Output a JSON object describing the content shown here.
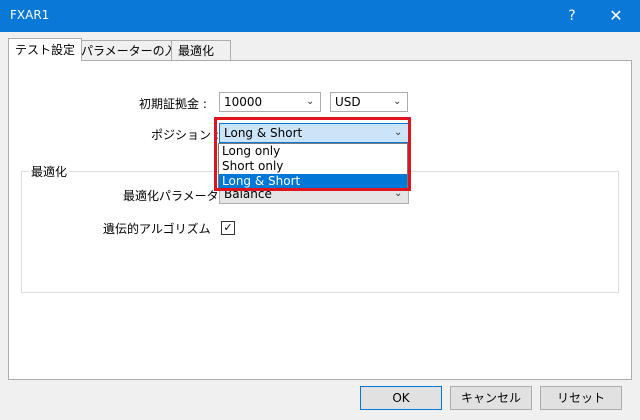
{
  "window": {
    "title": "FXAR1",
    "help_glyph": "?",
    "close_glyph": "✕"
  },
  "tabs": [
    {
      "label": "テスト設定"
    },
    {
      "label": "パラメーターの入力"
    },
    {
      "label": "最適化"
    }
  ],
  "form": {
    "deposit_label": "初期証拠金 :",
    "deposit_value": "10000",
    "currency_value": "USD",
    "position_label": "ポジション :",
    "position_value": "Long & Short",
    "dropdown_options": [
      "Long only",
      "Short only",
      "Long & Short"
    ],
    "selected_option_index": 2
  },
  "optimization": {
    "group_title": "最適化",
    "param_label": "最適化パラメータ :",
    "param_value": "Balance",
    "genetic_label": "遺伝的アルゴリズム",
    "genetic_checked": true,
    "check_glyph": "✓"
  },
  "buttons": {
    "ok": "OK",
    "cancel": "キャンセル",
    "reset": "リセット"
  },
  "colors": {
    "titlebar": "#0a78d7",
    "highlight": "#e0141e",
    "selection": "#0078d7"
  },
  "icons": {
    "chevron": "chevron-down-icon"
  }
}
